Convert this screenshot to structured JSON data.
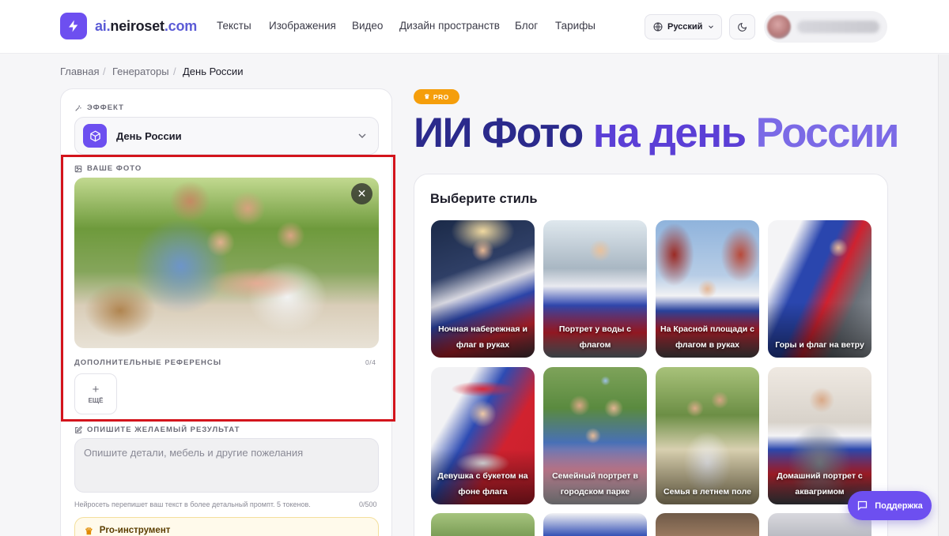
{
  "header": {
    "logo_prefix": "ai.",
    "logo_middle": "neiroset",
    "logo_suffix": ".com",
    "nav": [
      "Тексты",
      "Изображения",
      "Видео",
      "Дизайн пространств",
      "Блог",
      "Тарифы"
    ],
    "language": "Русский"
  },
  "breadcrumb": [
    "Главная",
    "Генераторы",
    "День России"
  ],
  "left_panel": {
    "effect_label": "ЭФФЕКТ",
    "effect_value": "День России",
    "photo_label": "ВАШЕ ФОТО",
    "refs_label": "ДОПОЛНИТЕЛЬНЫЕ РЕФЕРЕНСЫ",
    "refs_count": "0/4",
    "add_more": "ЕЩЁ",
    "describe_label": "ОПИШИТЕ ЖЕЛАЕМЫЙ РЕЗУЛЬТАТ",
    "describe_placeholder": "Опишите детали, мебель и другие пожелания",
    "hint": "Нейросеть перепишет ваш текст в более детальный промпт. 5 токенов.",
    "char_count": "0/500",
    "pro_tool": "Pro-инструмент"
  },
  "hero": {
    "badge": "PRO",
    "title_part1": "ИИ Фото",
    "title_part2": "на день",
    "title_part3": "России"
  },
  "styles": {
    "title": "Выберите стиль",
    "items": [
      {
        "line1": "Ночная набережная и",
        "line2": "флаг в руках"
      },
      {
        "line1": "Портрет у воды с",
        "line2": "флагом"
      },
      {
        "line1": "На Красной площади с",
        "line2": "флагом в руках"
      },
      {
        "line1": "Горы и флаг на ветру",
        "line2": ""
      },
      {
        "line1": "Девушка с букетом на",
        "line2": "фоне флага"
      },
      {
        "line1": "Семейный портрет в",
        "line2": "городском парке"
      },
      {
        "line1": "Семья в летнем поле",
        "line2": ""
      },
      {
        "line1": "Домашний портрет с",
        "line2": "аквагримом"
      }
    ]
  },
  "support_label": "Поддержка"
}
